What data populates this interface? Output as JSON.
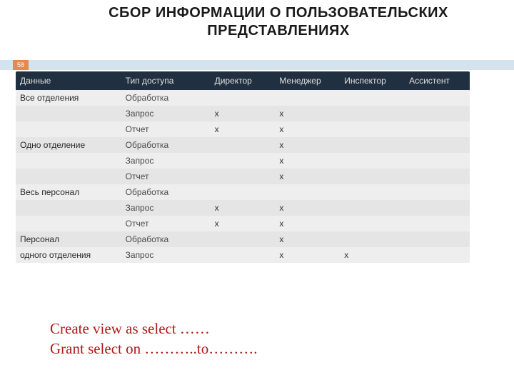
{
  "slide": {
    "title": "СБОР ИНФОРМАЦИИ О ПОЛЬЗОВАТЕЛЬСКИХ ПРЕДСТАВЛЕНИЯХ",
    "page_number": "58"
  },
  "table": {
    "headers": {
      "data": "Данные",
      "type": "Тип доступа",
      "role1": "Директор",
      "role2": "Менеджер",
      "role3": "Инспектор",
      "role4": "Ассистент"
    },
    "rows": [
      {
        "data": "Все отделения",
        "type": "Обработка",
        "r1": "",
        "r2": "",
        "r3": "",
        "r4": ""
      },
      {
        "data": "",
        "type": "Запрос",
        "r1": "x",
        "r2": "x",
        "r3": "",
        "r4": ""
      },
      {
        "data": "",
        "type": "Отчет",
        "r1": "x",
        "r2": "x",
        "r3": "",
        "r4": ""
      },
      {
        "data": "Одно отделение",
        "type": "Обработка",
        "r1": "",
        "r2": "x",
        "r3": "",
        "r4": ""
      },
      {
        "data": "",
        "type": "Запрос",
        "r1": "",
        "r2": "x",
        "r3": "",
        "r4": ""
      },
      {
        "data": "",
        "type": "Отчет",
        "r1": "",
        "r2": "x",
        "r3": "",
        "r4": ""
      },
      {
        "data": "Весь персонал",
        "type": "Обработка",
        "r1": "",
        "r2": "",
        "r3": "",
        "r4": ""
      },
      {
        "data": "",
        "type": "Запрос",
        "r1": "x",
        "r2": "x",
        "r3": "",
        "r4": ""
      },
      {
        "data": "",
        "type": "Отчет",
        "r1": "x",
        "r2": "x",
        "r3": "",
        "r4": ""
      },
      {
        "data": "Персонал",
        "type": "Обработка",
        "r1": "",
        "r2": "x",
        "r3": "",
        "r4": ""
      },
      {
        "data": "одного отделения",
        "type": "Запрос",
        "r1": "",
        "r2": "x",
        "r3": "x",
        "r4": ""
      }
    ]
  },
  "footer": {
    "line1": "Create view as select ……",
    "line2": "Grant select on ………..to………."
  }
}
